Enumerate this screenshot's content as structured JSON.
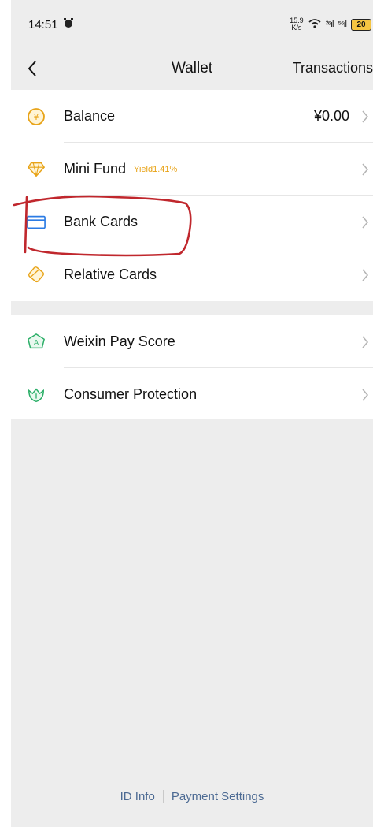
{
  "status_bar": {
    "time": "14:51",
    "net_speed_value": "15.9",
    "net_speed_unit": "K/s",
    "signal_1": "²⁶ıl",
    "signal_2": "⁵⁶ıl",
    "battery": "20"
  },
  "nav": {
    "title": "Wallet",
    "action": "Transactions"
  },
  "wallet_items": [
    {
      "label": "Balance",
      "value": "¥0.00",
      "icon": "yuan-coin-icon"
    },
    {
      "label": "Mini Fund",
      "badge": "Yield1.41%",
      "icon": "diamond-icon"
    },
    {
      "label": "Bank Cards",
      "icon": "bank-card-icon"
    },
    {
      "label": "Relative Cards",
      "icon": "relative-card-icon"
    }
  ],
  "service_items": [
    {
      "label": "Weixin Pay Score",
      "icon": "pay-score-icon"
    },
    {
      "label": "Consumer Protection",
      "icon": "protection-icon"
    }
  ],
  "footer": {
    "id_info": "ID Info",
    "payment_settings": "Payment Settings"
  },
  "colors": {
    "accent_gold": "#e8a317",
    "accent_green": "#2aae67",
    "accent_blue": "#2b7be4",
    "link_blue": "#4c6a93",
    "annotation_red": "#c0272d"
  }
}
